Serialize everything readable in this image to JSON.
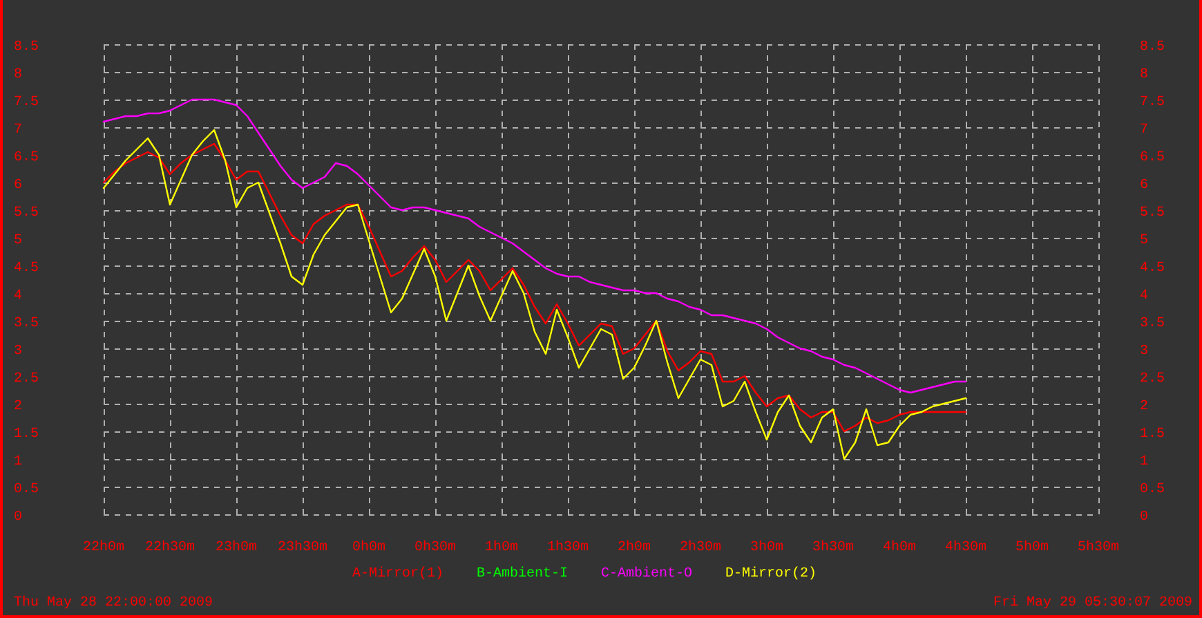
{
  "chart_data": {
    "type": "line",
    "grid": true,
    "ylim": [
      0,
      8.5
    ],
    "categories": [
      "22h0m",
      null,
      null,
      null,
      null,
      null,
      "22h30m",
      null,
      null,
      null,
      null,
      null,
      "23h0m",
      null,
      null,
      null,
      null,
      null,
      "23h30m",
      null,
      null,
      null,
      null,
      null,
      "0h0m",
      null,
      null,
      null,
      null,
      null,
      "0h30m",
      null,
      null,
      null,
      null,
      null,
      "1h0m",
      null,
      null,
      null,
      null,
      null,
      "1h30m",
      null,
      null,
      null,
      null,
      null,
      "2h0m",
      null,
      null,
      null,
      null,
      null,
      "2h30m",
      null,
      null,
      null,
      null,
      null,
      "3h0m",
      null,
      null,
      null,
      null,
      null,
      "3h30m",
      null,
      null,
      null,
      null,
      null,
      "4h0m",
      null,
      null,
      null,
      null,
      null,
      "4h30m",
      null,
      null,
      null,
      null,
      null,
      "5h0m",
      null,
      null,
      null,
      null,
      null,
      "5h30m"
    ],
    "yticks": [
      {
        "value": 0,
        "label": "0"
      },
      {
        "value": 0.5,
        "label": "0.5"
      },
      {
        "value": 1,
        "label": "1"
      },
      {
        "value": 1.5,
        "label": "1.5"
      },
      {
        "value": 2,
        "label": "2"
      },
      {
        "value": 2.5,
        "label": "2.5"
      },
      {
        "value": 3,
        "label": "3"
      },
      {
        "value": 3.5,
        "label": "3.5"
      },
      {
        "value": 4,
        "label": "4"
      },
      {
        "value": 4.5,
        "label": "4.5"
      },
      {
        "value": 5,
        "label": "5"
      },
      {
        "value": 5.5,
        "label": "5.5"
      },
      {
        "value": 6,
        "label": "6"
      },
      {
        "value": 6.5,
        "label": "6.5"
      },
      {
        "value": 7,
        "label": "7"
      },
      {
        "value": 7.5,
        "label": "7.5"
      },
      {
        "value": 8,
        "label": "8"
      },
      {
        "value": 8.5,
        "label": "8.5"
      }
    ],
    "series": [
      {
        "name": "A-Mirror(1)",
        "color": "#ff0000",
        "values": [
          6.0,
          6.2,
          6.35,
          6.45,
          6.55,
          6.45,
          6.15,
          6.35,
          6.5,
          6.6,
          6.7,
          6.4,
          6.05,
          6.2,
          6.2,
          5.8,
          5.4,
          5.05,
          4.9,
          5.25,
          5.4,
          5.5,
          5.6,
          5.6,
          5.2,
          4.75,
          4.3,
          4.4,
          4.65,
          4.85,
          4.6,
          4.2,
          4.4,
          4.6,
          4.4,
          4.05,
          4.25,
          4.45,
          4.15,
          3.75,
          3.45,
          3.8,
          3.45,
          3.05,
          3.25,
          3.45,
          3.4,
          2.9,
          3.0,
          3.25,
          3.5,
          2.95,
          2.6,
          2.75,
          2.95,
          2.9,
          2.4,
          2.4,
          2.5,
          2.2,
          1.95,
          2.1,
          2.15,
          1.9,
          1.75,
          1.85,
          1.85,
          1.5,
          1.6,
          1.75,
          1.65,
          1.7,
          1.8,
          1.85,
          1.85,
          1.85,
          1.85,
          1.85,
          1.85,
          null,
          null,
          null,
          null,
          null,
          null,
          null,
          null,
          null,
          null,
          null,
          null
        ]
      },
      {
        "name": "B-Ambient-I",
        "color": "#00ff00",
        "values": [
          null,
          null,
          null,
          null,
          null,
          null,
          null,
          null,
          null,
          null,
          null,
          null,
          null,
          null,
          null,
          null,
          null,
          null,
          null,
          null,
          null,
          null,
          null,
          null,
          null,
          null,
          null,
          null,
          null,
          null,
          null,
          null,
          null,
          null,
          null,
          null,
          null,
          null,
          null,
          null,
          null,
          null,
          null,
          null,
          null,
          null,
          null,
          null,
          null,
          null,
          null,
          null,
          null,
          null,
          null,
          null,
          null,
          null,
          null,
          null,
          null,
          null,
          null,
          null,
          null,
          null,
          null,
          null,
          null,
          null,
          null,
          null,
          null,
          null,
          null,
          null,
          null,
          null,
          null,
          null,
          null,
          null,
          null,
          null,
          null,
          null,
          null,
          null,
          null,
          null,
          null
        ]
      },
      {
        "name": "C-Ambient-O",
        "color": "#ff00ff",
        "values": [
          7.1,
          7.15,
          7.2,
          7.2,
          7.25,
          7.25,
          7.3,
          7.4,
          7.5,
          7.5,
          7.5,
          7.45,
          7.4,
          7.2,
          6.9,
          6.6,
          6.3,
          6.05,
          5.9,
          6.0,
          6.1,
          6.35,
          6.3,
          6.15,
          5.95,
          5.75,
          5.55,
          5.5,
          5.55,
          5.55,
          5.5,
          5.45,
          5.4,
          5.35,
          5.2,
          5.1,
          5.0,
          4.9,
          4.75,
          4.6,
          4.45,
          4.35,
          4.3,
          4.3,
          4.2,
          4.15,
          4.1,
          4.05,
          4.05,
          4.0,
          4.0,
          3.9,
          3.85,
          3.75,
          3.7,
          3.6,
          3.6,
          3.55,
          3.5,
          3.45,
          3.35,
          3.2,
          3.1,
          3.0,
          2.95,
          2.85,
          2.8,
          2.7,
          2.65,
          2.55,
          2.45,
          2.35,
          2.25,
          2.2,
          2.25,
          2.3,
          2.35,
          2.4,
          2.4,
          null,
          null,
          null,
          null,
          null,
          null,
          null,
          null,
          null,
          null,
          null,
          null
        ]
      },
      {
        "name": "D-Mirror(2)",
        "color": "#ffff00",
        "values": [
          5.9,
          6.15,
          6.4,
          6.6,
          6.8,
          6.5,
          5.6,
          6.05,
          6.5,
          6.75,
          6.95,
          6.4,
          5.55,
          5.9,
          6.0,
          5.45,
          4.9,
          4.3,
          4.15,
          4.7,
          5.05,
          5.3,
          5.55,
          5.6,
          4.95,
          4.3,
          3.65,
          3.9,
          4.35,
          4.8,
          4.3,
          3.5,
          4.0,
          4.5,
          3.95,
          3.5,
          3.95,
          4.4,
          4.0,
          3.3,
          2.9,
          3.7,
          3.2,
          2.65,
          3.0,
          3.35,
          3.25,
          2.45,
          2.65,
          3.05,
          3.5,
          2.75,
          2.1,
          2.45,
          2.8,
          2.7,
          1.95,
          2.05,
          2.4,
          1.85,
          1.35,
          1.85,
          2.15,
          1.6,
          1.3,
          1.75,
          1.9,
          1.0,
          1.3,
          1.9,
          1.25,
          1.3,
          1.6,
          1.8,
          1.85,
          1.95,
          2.0,
          2.05,
          2.1,
          null,
          null,
          null,
          null,
          null,
          null,
          null,
          null,
          null,
          null,
          null,
          null
        ]
      }
    ]
  },
  "right_axis": {
    "ticks": [
      "8.5",
      "8",
      "7.5",
      "7",
      "6.5",
      "6",
      "5.5",
      "5",
      "4.5",
      "4",
      "3.5",
      "3",
      "2.5",
      "2",
      "1.5",
      "1",
      "0.5",
      "0"
    ]
  },
  "start_time": "Thu May 28 22:00:00 2009",
  "end_time": "Fri May 29 05:30:07 2009"
}
